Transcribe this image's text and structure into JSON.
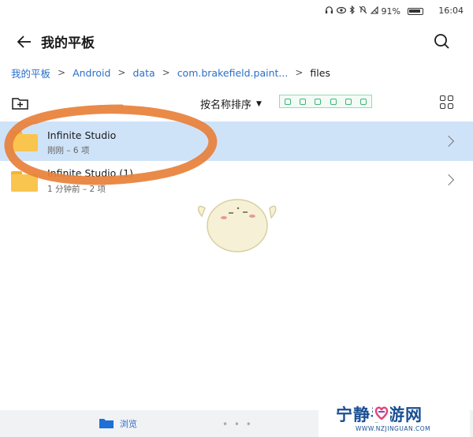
{
  "status_bar": {
    "icons": [
      "headphones-icon",
      "eye-icon",
      "bluetooth-icon",
      "mute-icon",
      "no-signal-icon"
    ],
    "battery": "91%",
    "time": "16:04"
  },
  "header": {
    "title": "我的平板"
  },
  "breadcrumb": [
    {
      "label": "我的平板"
    },
    {
      "label": "Android"
    },
    {
      "label": "data"
    },
    {
      "label": "com.brakefield.paint..."
    },
    {
      "label": "files"
    }
  ],
  "toolbar": {
    "sort_label": "按名称排序",
    "sort_arrow": "▼"
  },
  "files": [
    {
      "name": "Infinite Studio",
      "meta": "刚刚 – 6 项",
      "selected": true
    },
    {
      "name": "Infinite Studio (1)",
      "meta": "1 分钟前 – 2 项",
      "selected": false
    }
  ],
  "bottom_nav": {
    "browse_label": "浏览",
    "dots": "• • •"
  },
  "watermark": {
    "text": "宁静手游网",
    "url": "WWW.NZJINGUAN.COM"
  },
  "colors": {
    "accent": "#2a6fc9",
    "selected_row": "#cfe3f8",
    "folder": "#f9c54f",
    "annotation": "#e8803a"
  }
}
